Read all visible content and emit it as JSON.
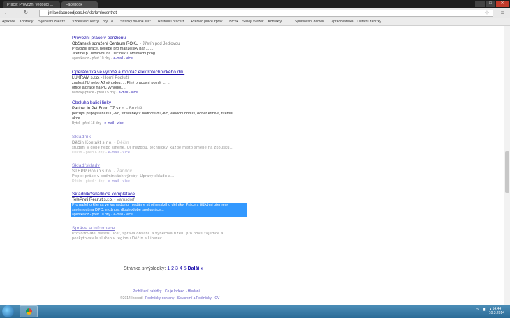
{
  "browser": {
    "tabs": [
      {
        "label": "Práce: Provozní vedoucí ..."
      },
      {
        "label": "Facebook"
      }
    ],
    "address": "jmlaedaxnoodjobs.ks/klcrkrnlocsntrdt",
    "bookmarks": [
      "Aplikace",
      "Kontakty",
      "Zvyšování zakázk...",
      "Vzdělávací kurzy",
      "hry... o...",
      "Stránky on-line služ...",
      "Rostoucí práce z...",
      "Přehled práce zpráv...",
      "Brcnk",
      "Silnějí svazek",
      "Kontakty: ...",
      "",
      "Spravování domén...",
      "Zpracovatelka",
      "Ostatní záložky"
    ]
  },
  "results": [
    {
      "title": "Provozní práce v penzionu",
      "company": "Občanské sdružení Centrum ROKU",
      "location": "Jiřetín pod Jedlovou",
      "desc": [
        "Provozní práce, nejlépe pro manželský pár ... ...",
        "Jiřetíně p. Jedlovou na Děčínsku. Motivační prog..."
      ],
      "meta": "agentka.cz - před 10 dny",
      "links": [
        "e-mail",
        "více"
      ]
    },
    {
      "title": "Operátor/ka ve výrobě a montáž elektrotechnického dílu",
      "company": "LUKRAM s.r.o.",
      "location": "Horní Podluží",
      "desc": [
        "znalost NJ nebo AJ výhodou. ... Plný pracovní poměr ... ...",
        "office a práce na PC výhodou..."
      ],
      "meta": "nabidky-prace - před 15 dny",
      "links": [
        "e-mail",
        "více"
      ]
    },
    {
      "title": "Obsluha balicí linky",
      "company": "Partner in Pet Food CZ s.r.o.",
      "location": "Brniště",
      "desc": [
        "penzijní připojištění 600,-Kč, stravenky v hodnotě 80,-Kč, vánoční bonus, odběr krmiva, firemní",
        "akce..."
      ],
      "meta": "Bytel - před 18 dny",
      "links": [
        "e-mail",
        "více"
      ]
    },
    {
      "title": "Skladník",
      "company": "Děčín Kontakt s.r.o.",
      "location": "Děčín",
      "desc": [
        "studijní v době nebo směně. Uj mezdou, technicky, každé místo směně na zkoušku..."
      ],
      "meta": "Děčín - před 6 dny",
      "links": [
        "e-mail",
        "více"
      ]
    },
    {
      "title": "Sklad/sklady",
      "company": "STEPP Group s.r.o.",
      "location": "Žandov",
      "desc": [
        "Popis: práce v podmínkách výroby: Úpravy skladu a..."
      ],
      "meta": "Děčín - před 4 dny",
      "links": [
        "e-mail",
        "více"
      ]
    },
    {
      "title": "Skladník/Skladnice kompletace",
      "company": "TeleProfi Recruit s.r.o.",
      "location": "Varnsdorf",
      "desc": [
        "Pro našeho klienta ve Varnsdorfu, hledáme strojírenského dělníky. Práce s těžkými břemeny",
        "směnnost na DPC, možnost dlouhodobé spolupráce..."
      ],
      "meta": "agentka.cz - před 10 dny",
      "links": [
        "e-mail",
        "více"
      ]
    },
    {
      "title": "Správa a informace",
      "company": "",
      "location": "",
      "desc": [
        "Provozovatel vlastní účet, správa obsahu a výběrová řízení pro nové zájemce a",
        "poskytovatele služeb v regionu Děčín a Liberec..."
      ],
      "meta": "",
      "links": []
    }
  ],
  "pager": {
    "label": "Stránka s výsledky:",
    "pages": [
      "1",
      "2",
      "3",
      "4",
      "5"
    ],
    "next": "Další »"
  },
  "footer": {
    "links": "Prohlížení nabídky · Co je Indeed · Hledání",
    "copyright": "©2014 Indeed",
    "legal": "Podmínky ochrany · Soukromí a Podmínky · CV"
  },
  "taskbar": {
    "lang": "CS",
    "time": "14:44",
    "date": "10.3.2014"
  },
  "colors": {
    "link": "#1a0dab",
    "selection": "#3399ff",
    "taskbar": "#2b6a96"
  }
}
